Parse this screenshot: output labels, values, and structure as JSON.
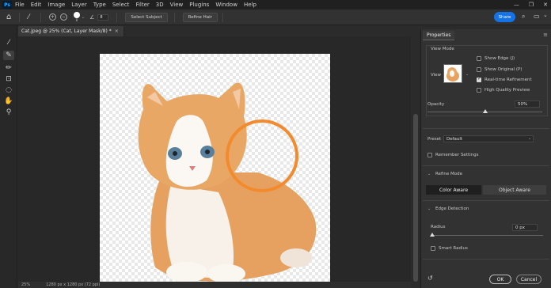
{
  "app": {
    "logo": "Ps"
  },
  "menu": [
    "File",
    "Edit",
    "Image",
    "Layer",
    "Type",
    "Select",
    "Filter",
    "3D",
    "View",
    "Plugins",
    "Window",
    "Help"
  ],
  "window_controls": [
    "—",
    "❐",
    "✕"
  ],
  "options_bar": {
    "size_value": "8",
    "size_unit": "8",
    "select_subject": "Select Subject",
    "refine_hair": "Refine Hair",
    "share": "Share"
  },
  "document": {
    "tab_title": "Cat.jpeg @ 25% (Cat, Layer Mask/8) *",
    "close": "×",
    "status_zoom": "25%",
    "status_size": "1280 px x 1280 px (72 ppi)"
  },
  "properties": {
    "tab": "Properties",
    "view_mode": {
      "header": "View Mode",
      "view_label": "View",
      "options": [
        {
          "label": "Show Edge (J)",
          "checked": false
        },
        {
          "label": "Show Original (P)",
          "checked": false
        },
        {
          "label": "Real-time Refinement",
          "checked": true
        },
        {
          "label": "High Quality Preview",
          "checked": false
        }
      ]
    },
    "opacity": {
      "label": "Opacity",
      "value": "50%",
      "level": 0.5
    },
    "preset": {
      "label": "Preset",
      "value": "Default"
    },
    "remember": {
      "label": "Remember Settings",
      "checked": false
    },
    "refine_mode": {
      "header": "Refine Mode",
      "options": [
        "Color Aware",
        "Object Aware"
      ],
      "active": "Color Aware"
    },
    "edge_detection": {
      "header": "Edge Detection",
      "radius": {
        "label": "Radius",
        "value": "0 px",
        "level": 0
      },
      "smart_radius": {
        "label": "Smart Radius",
        "checked": false
      }
    },
    "buttons": {
      "ok": "OK",
      "cancel": "Cancel"
    }
  },
  "colors": {
    "accent_blue": "#1473e6",
    "brush_circle": "#f28a2e",
    "checker": "#e8e8e8"
  }
}
